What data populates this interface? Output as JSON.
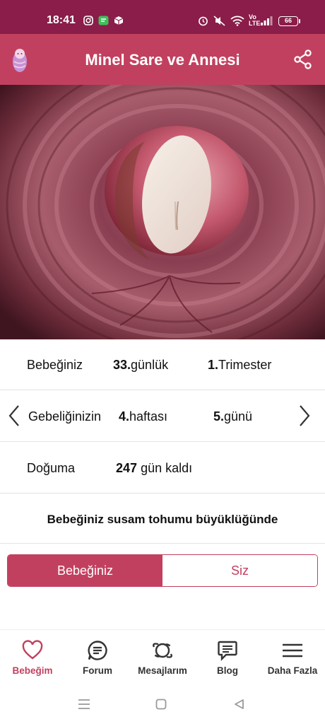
{
  "status_bar": {
    "time": "18:41",
    "battery": "66",
    "network": "Vo LTE",
    "icons": [
      "instagram-icon",
      "messages-icon",
      "box-icon",
      "alarm-icon",
      "mute-icon",
      "wifi-icon",
      "signal-icon",
      "battery-icon"
    ]
  },
  "header": {
    "title": "Minel Sare ve Annesi",
    "avatar_icon": "baby-avatar-icon",
    "share_icon": "share-icon"
  },
  "summary": {
    "row1": {
      "label": "Bebeğiniz",
      "days_num": "33.",
      "days_text": "günlük",
      "trimester_num": "1.",
      "trimester_text": "Trimester"
    },
    "row2": {
      "label": "Gebeliğinizin",
      "week_num": "4.",
      "week_text": "haftası",
      "day_num": "5.",
      "day_text": "günü"
    },
    "row3": {
      "label": "Doğuma",
      "remaining_num": "247",
      "remaining_text": "gün kaldı"
    },
    "size_text": "Bebeğiniz susam tohumu büyüklüğünde"
  },
  "segmented": {
    "baby_label": "Bebeğiniz",
    "you_label": "Siz",
    "selected": "Bebeğiniz"
  },
  "bottom_nav": {
    "items": [
      {
        "label": "Bebeğim",
        "icon": "heart-icon",
        "active": true
      },
      {
        "label": "Forum",
        "icon": "forum-icon",
        "active": false
      },
      {
        "label": "Mesajlarım",
        "icon": "messages-planet-icon",
        "active": false
      },
      {
        "label": "Blog",
        "icon": "blog-icon",
        "active": false
      },
      {
        "label": "Daha Fazla",
        "icon": "menu-icon",
        "active": false
      }
    ]
  },
  "colors": {
    "status_bar": "#8a1d4a",
    "accent": "#c2405f"
  }
}
